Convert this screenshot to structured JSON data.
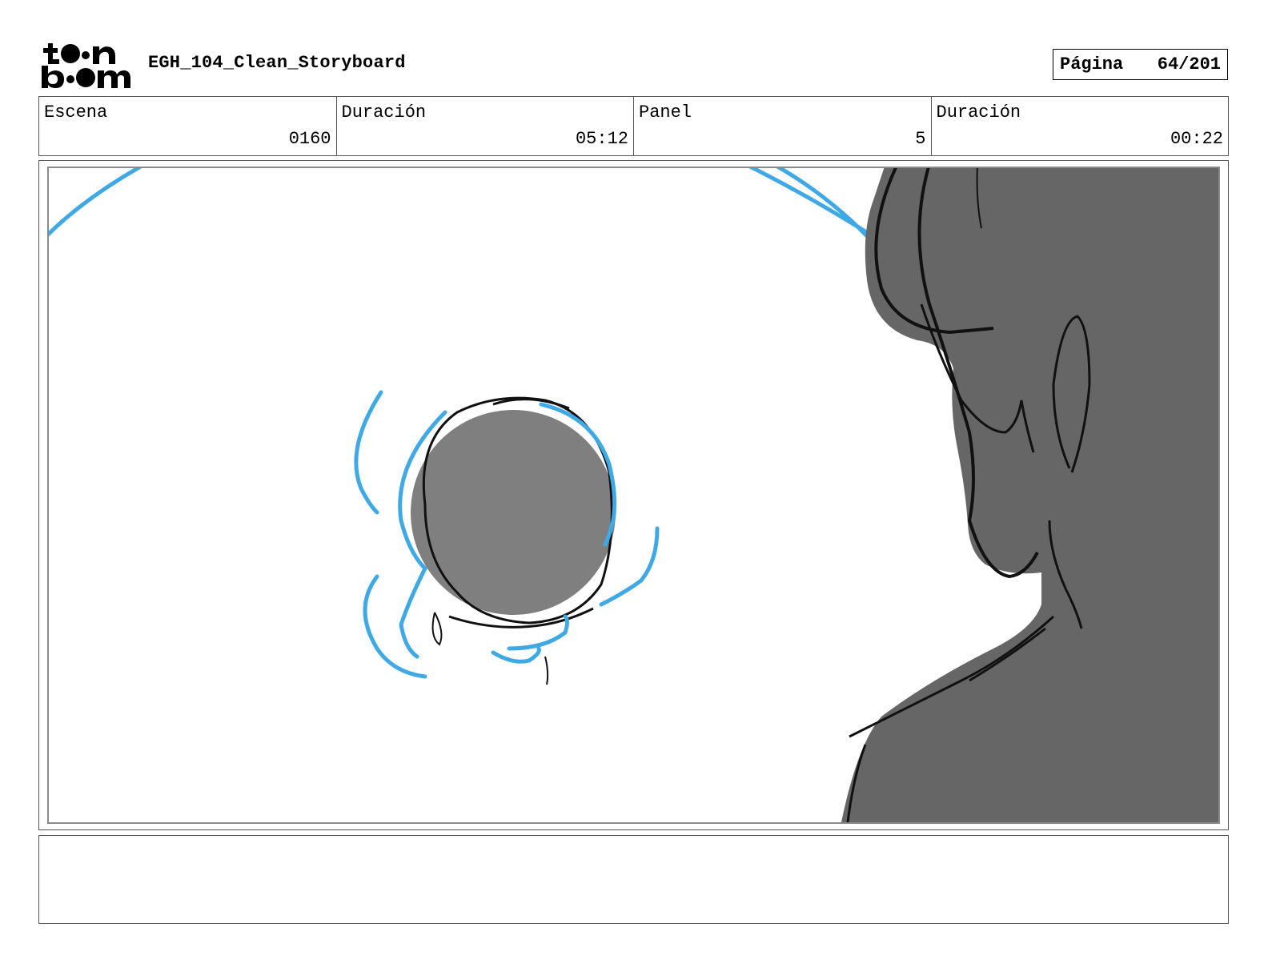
{
  "header": {
    "logo_text": "toon boom",
    "document_title": "EGH_104_Clean_Storyboard",
    "page_label": "Página",
    "page_number": "64/201"
  },
  "info": {
    "scene_label": "Escena",
    "scene_value": "0160",
    "scene_duration_label": "Duración",
    "scene_duration_value": "05:12",
    "panel_label": "Panel",
    "panel_value": "5",
    "panel_duration_label": "Duración",
    "panel_duration_value": "00:22"
  },
  "panel": {
    "colors": {
      "fill_gray": "#7f7f7f",
      "dark_gray": "#666666",
      "line": "#111111",
      "motion_blue": "#3fa9e6"
    }
  },
  "notes": {
    "text": ""
  }
}
